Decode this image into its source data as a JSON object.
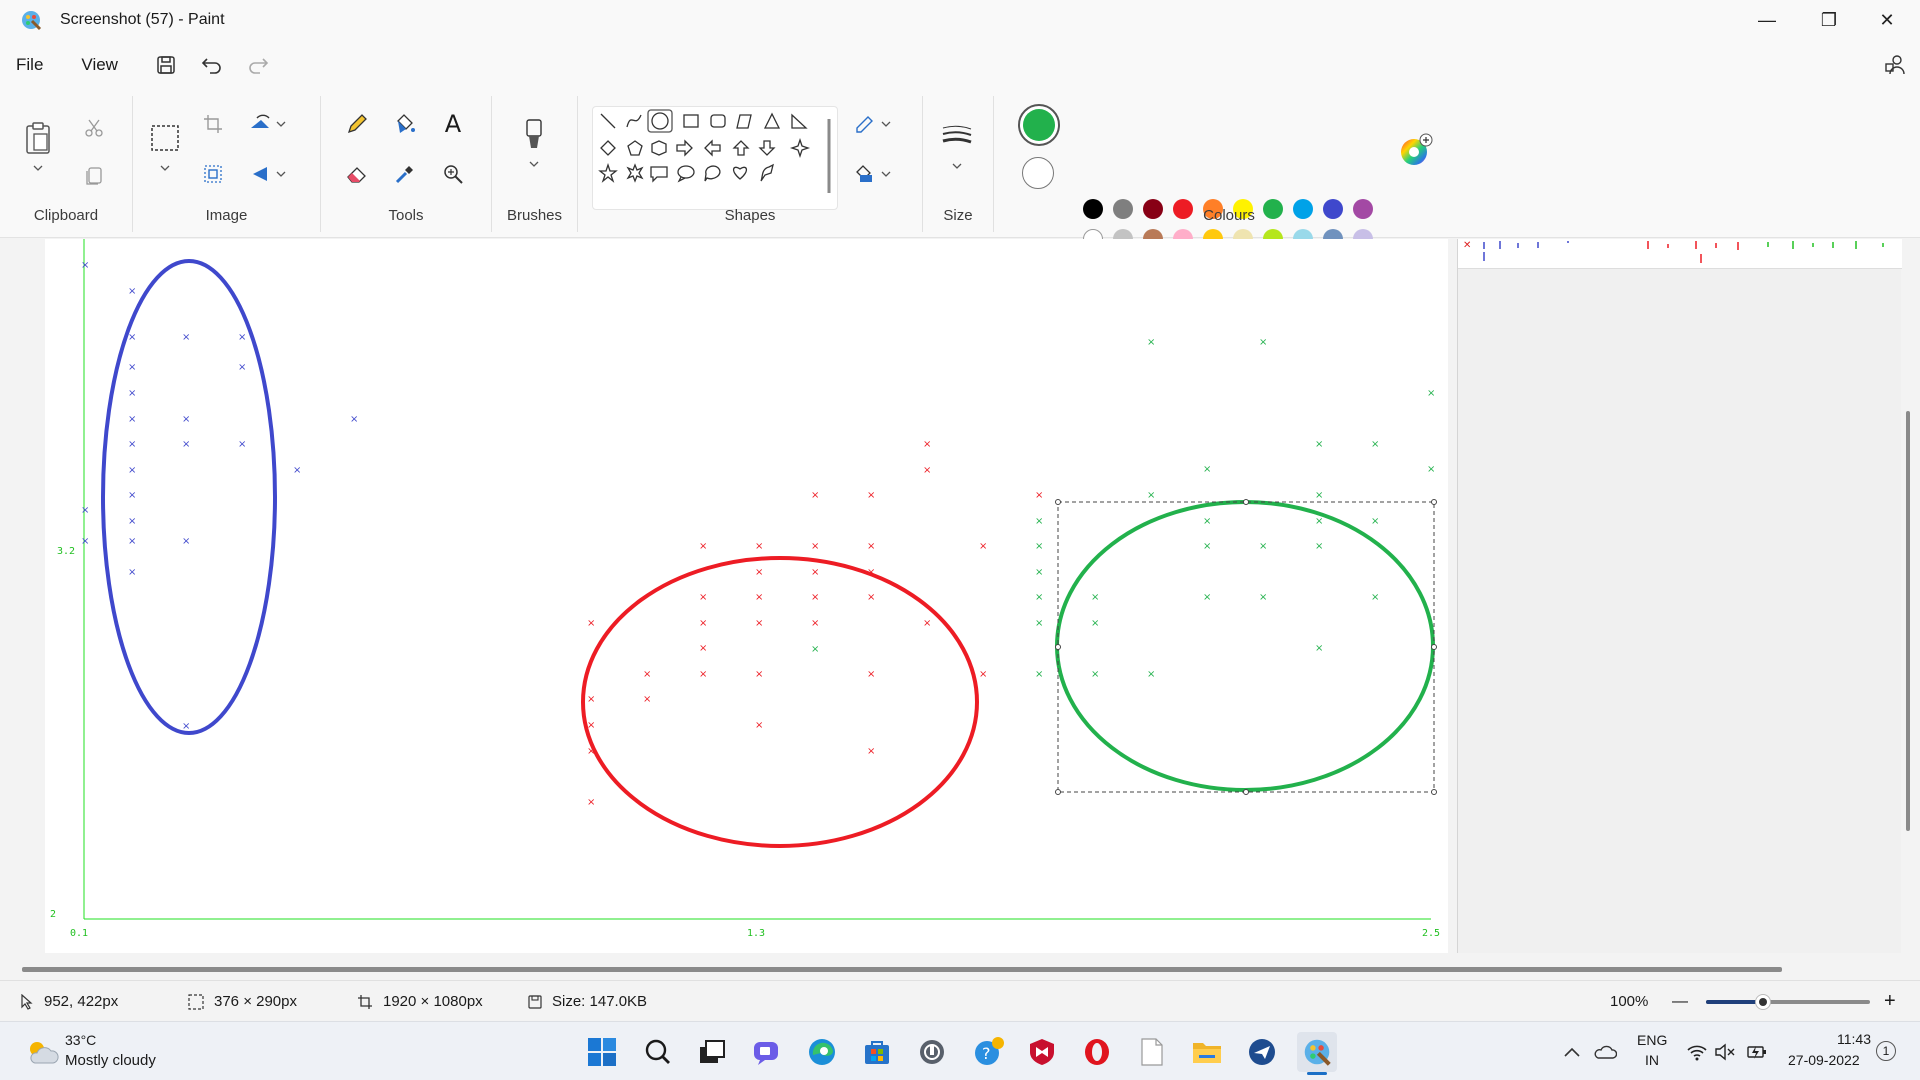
{
  "window": {
    "title": "Screenshot (57) - Paint",
    "minimize_glyph": "—",
    "restore_glyph": "❐",
    "close_glyph": "✕"
  },
  "menu": {
    "file": "File",
    "view": "View"
  },
  "ribbon": {
    "groups": {
      "clipboard": "Clipboard",
      "image": "Image",
      "tools": "Tools",
      "brushes": "Brushes",
      "shapes": "Shapes",
      "size": "Size",
      "colours": "Colours"
    },
    "text_tool_glyph": "A"
  },
  "colors": {
    "primary": "#22b14c",
    "secondary": "#ffffff",
    "row1": [
      "#000000",
      "#7f7f7f",
      "#880015",
      "#ed1c24",
      "#ff7f27",
      "#fff200",
      "#22b14c",
      "#00a2e8",
      "#3f48cc",
      "#a349a4"
    ],
    "row2": [
      "#ffffff",
      "#c3c3c3",
      "#b97a57",
      "#ffaec9",
      "#ffc90e",
      "#efe4b0",
      "#b5e61d",
      "#99d9ea",
      "#7092be",
      "#c8bfe7"
    ],
    "row3_empty_count": 10
  },
  "plot": {
    "y_ticks": [
      "3.2",
      "2"
    ],
    "x_ticks": [
      "0.1",
      "1.3",
      "2.5"
    ],
    "marker": "×",
    "blue_color": "#3f48cc",
    "red_color": "#ed1c24",
    "green_color": "#22b14c"
  },
  "status": {
    "cursor": "952, 422px",
    "selection": "376 × 290px",
    "canvas_size": "1920 × 1080px",
    "file_size": "Size: 147.0KB",
    "zoom": "100%",
    "zoom_out": "—",
    "zoom_in": "+",
    "zoom_level": 0.35
  },
  "taskbar": {
    "weather_temp": "33°C",
    "weather_desc": "Mostly cloudy",
    "lang_line1": "ENG",
    "lang_line2": "IN",
    "time": "11:43",
    "date": "27-09-2022",
    "notification_count": "1"
  }
}
